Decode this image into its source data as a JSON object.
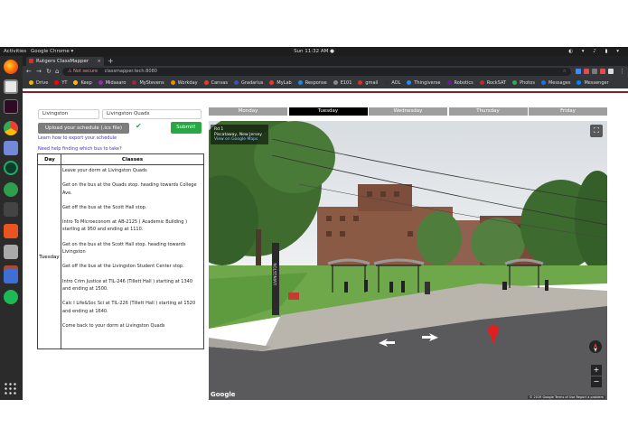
{
  "topbar": {
    "activities": "Activities",
    "app": "Google Chrome ▾",
    "clock": "Sun 11:32 AM ●",
    "tray": "◐ ▾ ♪ ▮ ▾"
  },
  "browser": {
    "tab_title": "Rutgers ClassMapper",
    "new_tab": "+",
    "not_secure": "⚠ Not secure",
    "url": "classmapper.tech:8080",
    "star": "☆",
    "bookmarks": [
      {
        "label": "Drive",
        "color": "#f4b400"
      },
      {
        "label": "YT",
        "color": "#ff0000"
      },
      {
        "label": "Keep",
        "color": "#fbbc04"
      },
      {
        "label": "Midasaro",
        "color": "#9c27b0"
      },
      {
        "label": "MyStevens",
        "color": "#a32638"
      },
      {
        "label": "Workday",
        "color": "#f38b00"
      },
      {
        "label": "Canvas",
        "color": "#e13f2b"
      },
      {
        "label": "Gradarius",
        "color": "#3f51b5"
      },
      {
        "label": "MyLab",
        "color": "#e53935"
      },
      {
        "label": "Response",
        "color": "#1e88e5"
      },
      {
        "label": "E101",
        "color": "#888888"
      },
      {
        "label": "gmail",
        "color": "#d93025"
      },
      {
        "label": "AOL",
        "color": "#333333"
      },
      {
        "label": "Thingiverse",
        "color": "#248bfb"
      },
      {
        "label": "Robotics",
        "color": "#6a1b9a"
      },
      {
        "label": "RockSAT",
        "color": "#c62828"
      },
      {
        "label": "Photos",
        "color": "#34a853"
      },
      {
        "label": "Messages",
        "color": "#1a73e8"
      },
      {
        "label": "Messenger",
        "color": "#0084ff"
      }
    ]
  },
  "form": {
    "campus": "Livingston",
    "stop": "Livingston Quads",
    "upload_label": "Upload your schedule (.ics file) here!",
    "check": "✔",
    "submit_label": "Submit!",
    "export_link": "Learn how to export your schedule",
    "help_link": "Need help finding which bus to take?"
  },
  "schedule": {
    "headers": [
      "Day",
      "Classes"
    ],
    "day": "Tuesday",
    "steps": [
      "Leave your dorm at Livingston Quads",
      "Get on the bus at the Quads stop. heading towards College Ave.",
      "Get off the bus at the Scott Hall stop.",
      "Intro To Microeconom at AB-2125 ( Academic Building ) starting at 950 and ending at 1110.",
      "Get on the bus at the Scott Hall stop. heading towards Livingston",
      "Get off the bus at the Livingston Student Center stop.",
      "Intro Crim Justice at TIL-246 (Tillett Hall ) starting at 1340 and ending at 1500.",
      "Calc I Life&Soc Sci at TIL-226 (Tillett Hall ) starting at 1520 and ending at 1640.",
      "Come back to your dorm at Livingston Quads"
    ]
  },
  "days": [
    "Monday",
    "Tuesday",
    "Wednesday",
    "Thursday",
    "Friday"
  ],
  "active_day": "Tuesday",
  "streetview": {
    "location_title": "Rd 1",
    "location_sub": "Piscataway, New Jersey",
    "location_link": "View on Google Maps",
    "sign_text": "LIVINGSTON",
    "google": "Google",
    "copyright": "© 2019 Google   Terms of Use   Report a problem",
    "fullscreen": "⛶",
    "zoom_in": "+",
    "zoom_out": "−"
  },
  "colors": {
    "accent_red": "#8a1f2b",
    "submit_green": "#28a745",
    "link": "#4b2bd6"
  }
}
